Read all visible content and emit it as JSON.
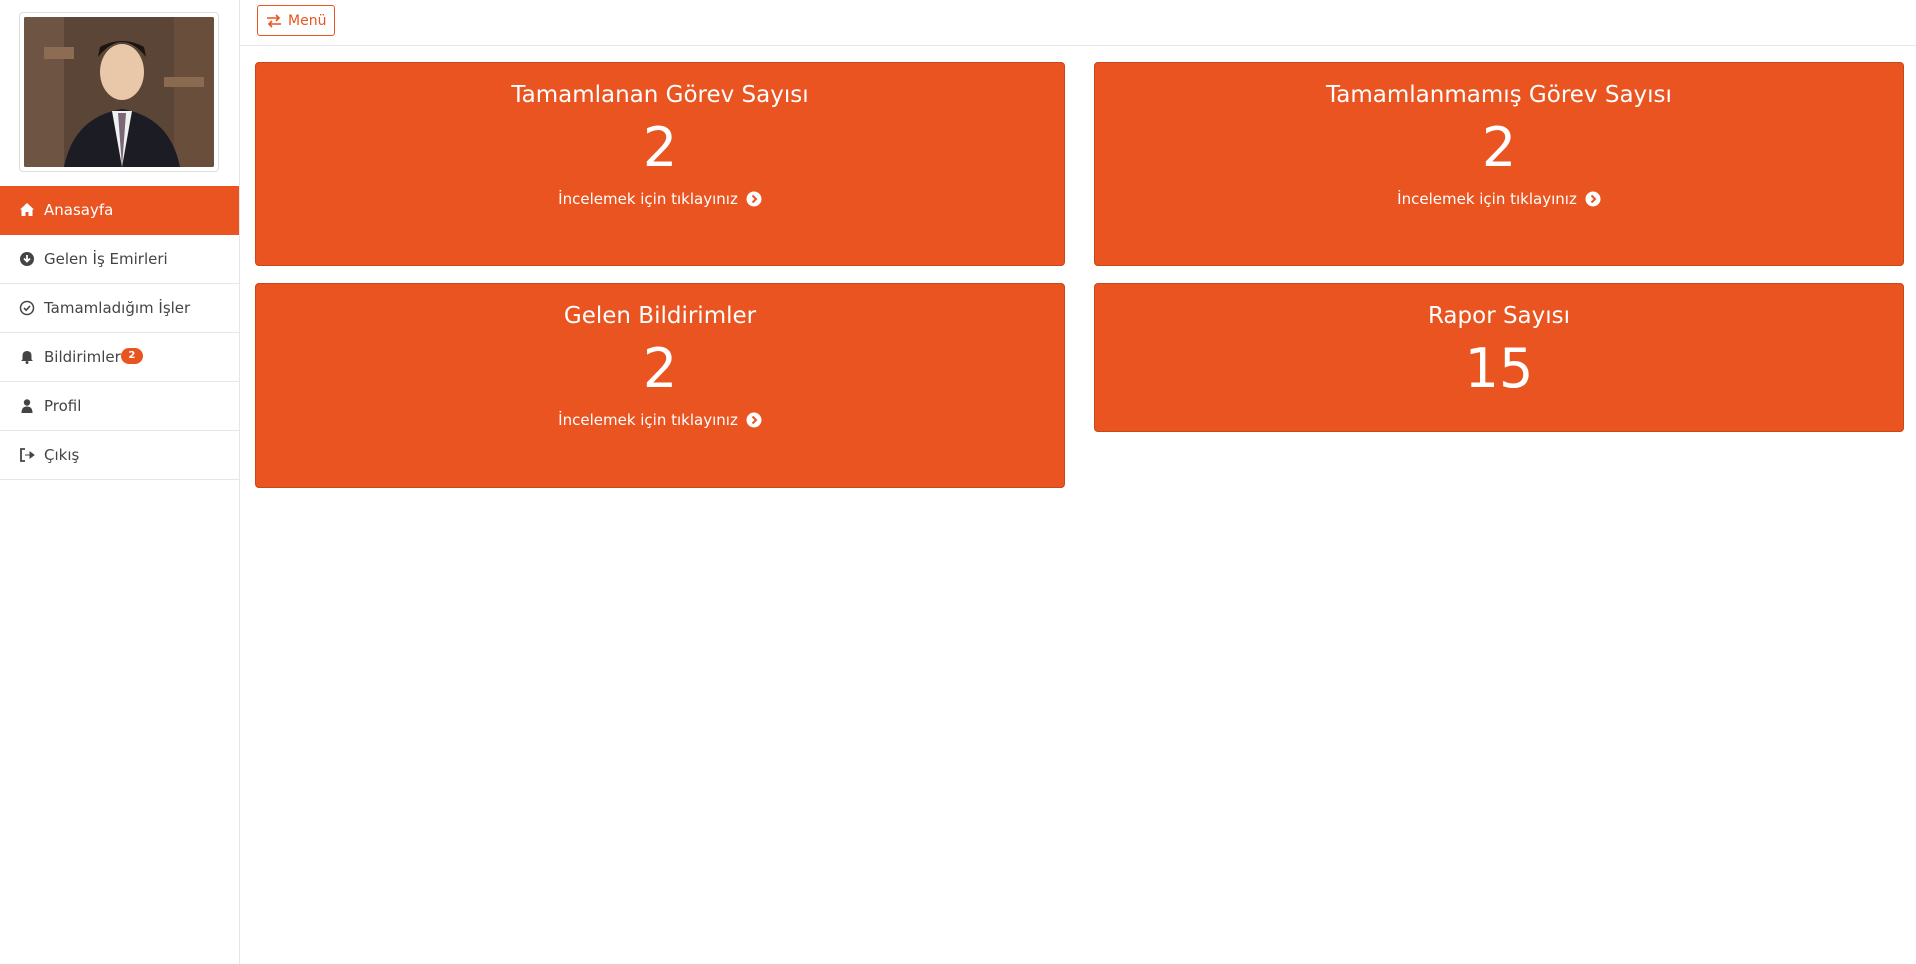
{
  "sidebar": {
    "avatar_alt": "profile-photo",
    "items": [
      {
        "label": "Anasayfa",
        "icon": "home-icon",
        "active": true
      },
      {
        "label": "Gelen İş Emirleri",
        "icon": "arrow-circle-down-icon",
        "active": false
      },
      {
        "label": "Tamamladığım İşler",
        "icon": "check-circle-icon",
        "active": false
      },
      {
        "label": "Bildirimler",
        "icon": "bell-icon",
        "active": false,
        "badge": "2"
      },
      {
        "label": "Profil",
        "icon": "user-icon",
        "active": false
      },
      {
        "label": "Çıkış",
        "icon": "sign-out-icon",
        "active": false
      }
    ]
  },
  "topbar": {
    "menu_label": "Menü",
    "menu_icon": "exchange-icon"
  },
  "cards": [
    {
      "title": "Tamamlanan Görev Sayısı",
      "value": "2",
      "link": "İncelemek için tıklayınız"
    },
    {
      "title": "Tamamlanmamış Görev Sayısı",
      "value": "2",
      "link": "İncelemek için tıklayınız"
    },
    {
      "title": "Gelen Bildirimler",
      "value": "2",
      "link": "İncelemek için tıklayınız"
    },
    {
      "title": "Rapor Sayısı",
      "value": "15"
    }
  ],
  "colors": {
    "accent": "#e95420",
    "border": "#e6e6e6",
    "text": "#444444"
  }
}
